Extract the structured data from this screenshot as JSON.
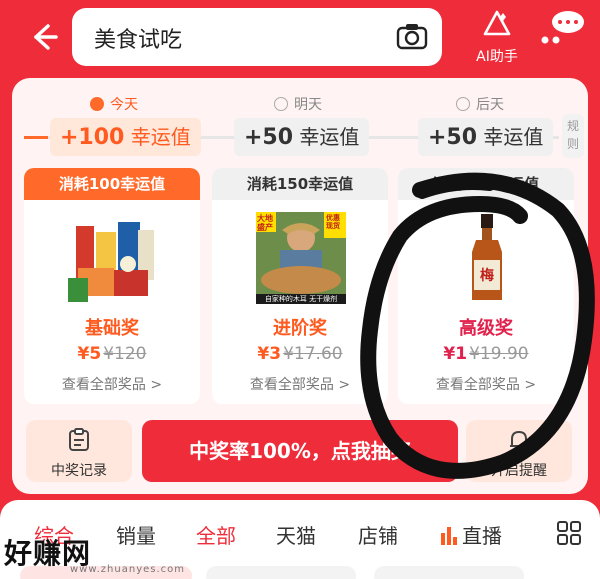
{
  "header": {
    "search_value": "美食试吃",
    "ai_label": "AI助手"
  },
  "days": [
    {
      "label": "今天",
      "active": true
    },
    {
      "label": "明天",
      "active": false
    },
    {
      "label": "后天",
      "active": false
    }
  ],
  "rewards": [
    {
      "label": "+100 幸运值",
      "amount": "+100",
      "unit": "幸运值"
    },
    {
      "label": "+50 幸运值",
      "amount": "+50",
      "unit": "幸运值"
    },
    {
      "label": "+50 幸运值",
      "amount": "+50",
      "unit": "幸运值"
    }
  ],
  "rule_label": "规则",
  "cards": [
    {
      "head": "消耗100幸运值",
      "title": "基础奖",
      "price_now": "¥5",
      "price_old": "¥120",
      "link": "查看全部奖品 >",
      "title_color": "#ff5a1f"
    },
    {
      "head": "消耗150幸运值",
      "title": "进阶奖",
      "price_now": "¥3",
      "price_old": "¥17.60",
      "link": "查看全部奖品 >",
      "title_color": "#ff5a1f"
    },
    {
      "head": "消耗300幸运值",
      "title": "高级奖",
      "price_now": "¥1",
      "price_old": "¥19.90",
      "link": "查看全部奖品 >",
      "title_color": "#e0224c"
    }
  ],
  "card2_img_text": {
    "top_left": "大地盛产",
    "top_right": "优惠现货",
    "bottom": "自家种的木耳 无干燥剂"
  },
  "actions": {
    "record": "中奖记录",
    "draw": "中奖率100%，点我抽奖",
    "remind": "开启提醒"
  },
  "tabs": [
    "综合",
    "销量",
    "全部",
    "天猫",
    "店铺",
    "直播"
  ],
  "watermark": {
    "main": "好赚网",
    "small": "www.zhuanyes.com"
  },
  "colors": {
    "brand_red": "#ef2c3a",
    "orange": "#ff5a1f"
  },
  "icons": [
    "back-arrow-icon",
    "camera-icon",
    "ai-assistant-icon",
    "more-icon",
    "record-icon",
    "bell-icon",
    "live-bars-icon",
    "grid-icon"
  ]
}
